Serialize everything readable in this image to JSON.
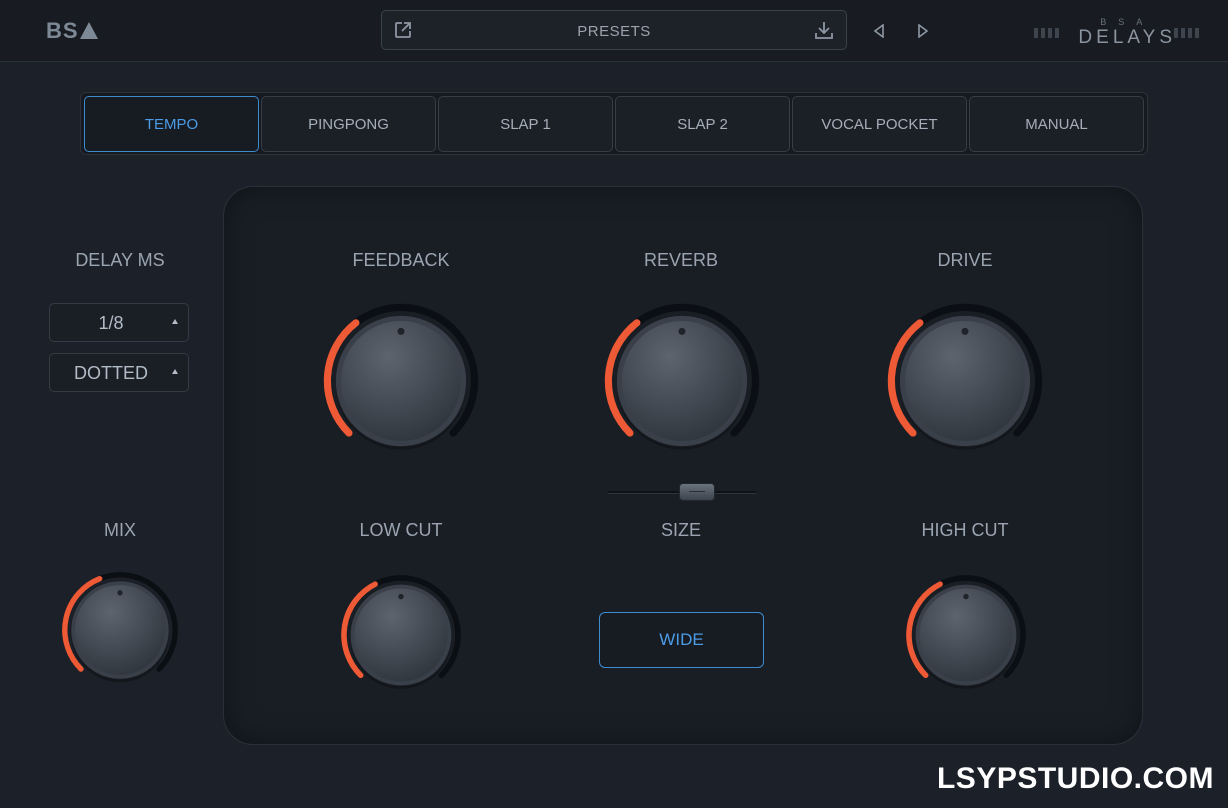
{
  "header": {
    "logo": "BS",
    "presets_label": "PRESETS",
    "brand_sub": "BSA",
    "brand_main": "DELAYS"
  },
  "tabs": [
    {
      "label": "TEMPO",
      "active": true
    },
    {
      "label": "PINGPONG",
      "active": false
    },
    {
      "label": "SLAP 1",
      "active": false
    },
    {
      "label": "SLAP 2",
      "active": false
    },
    {
      "label": "VOCAL POCKET",
      "active": false
    },
    {
      "label": "MANUAL",
      "active": false
    }
  ],
  "delay": {
    "label": "DELAY MS",
    "division": "1/8",
    "mode": "DOTTED"
  },
  "knobs": {
    "mix": {
      "label": "MIX",
      "level": 0.42
    },
    "feedback": {
      "label": "FEEDBACK",
      "level": 0.36
    },
    "reverb": {
      "label": "REVERB",
      "level": 0.36
    },
    "drive": {
      "label": "DRIVE",
      "level": 0.36
    },
    "low_cut": {
      "label": "LOW CUT",
      "level": 0.4
    },
    "high_cut": {
      "label": "HIGH CUT",
      "level": 0.4
    }
  },
  "size": {
    "label": "SIZE",
    "level": 0.62
  },
  "wide_label": "WIDE",
  "watermark": "LSYPSTUDIO.COM",
  "colors": {
    "accent_orange": "#ef5a36",
    "accent_blue": "#4c9be6"
  }
}
